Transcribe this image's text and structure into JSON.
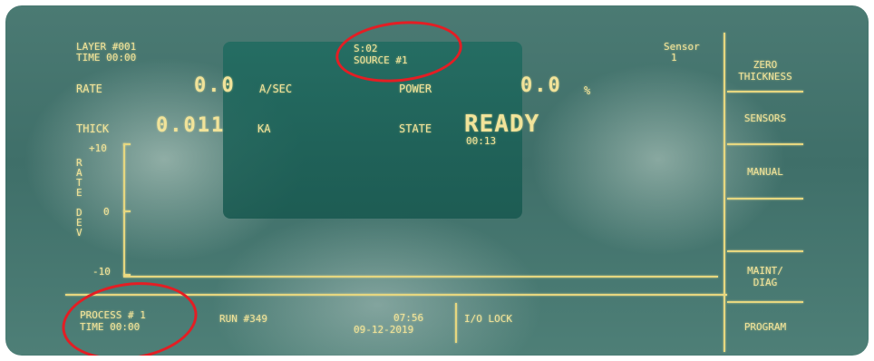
{
  "header": {
    "layer": "LAYER #001",
    "time": "TIME 00:00",
    "source_line1": "S:02",
    "source_line2": "SOURCE #1",
    "sensor_label": "Sensor",
    "sensor_value": "1"
  },
  "readouts": {
    "rate_label": "RATE",
    "rate_value": "0.0",
    "rate_unit": "A/SEC",
    "power_label": "POWER",
    "power_value": "0.0",
    "power_unit": "%",
    "thick_label": "THICK",
    "thick_value": "0.011",
    "thick_unit": "KA",
    "state_label": "STATE",
    "state_value": "READY",
    "state_timer": "00:13"
  },
  "graph": {
    "y_top": "+10",
    "y_mid": "0",
    "y_bottom": "-10",
    "axis_title": [
      "R",
      "A",
      "T",
      "E",
      "",
      "D",
      "E",
      "V"
    ]
  },
  "footer": {
    "process": "PROCESS # 1",
    "process_time": "TIME 00:00",
    "run": "RUN  #349",
    "clock_time": "07:56",
    "date": "09-12-2019",
    "io_lock": "I/O LOCK"
  },
  "menu": [
    {
      "line1": "ZERO",
      "line2": "THICKNESS"
    },
    {
      "line1": "SENSORS",
      "line2": ""
    },
    {
      "line1": "MANUAL",
      "line2": ""
    },
    {
      "line1": "",
      "line2": ""
    },
    {
      "line1": "MAINT/",
      "line2": "DIAG"
    },
    {
      "line1": "PROGRAM",
      "line2": ""
    }
  ],
  "colors": {
    "display_text": "#f1e39a",
    "annotation": "#e31e24",
    "screen_bg": "#3f6f69"
  }
}
